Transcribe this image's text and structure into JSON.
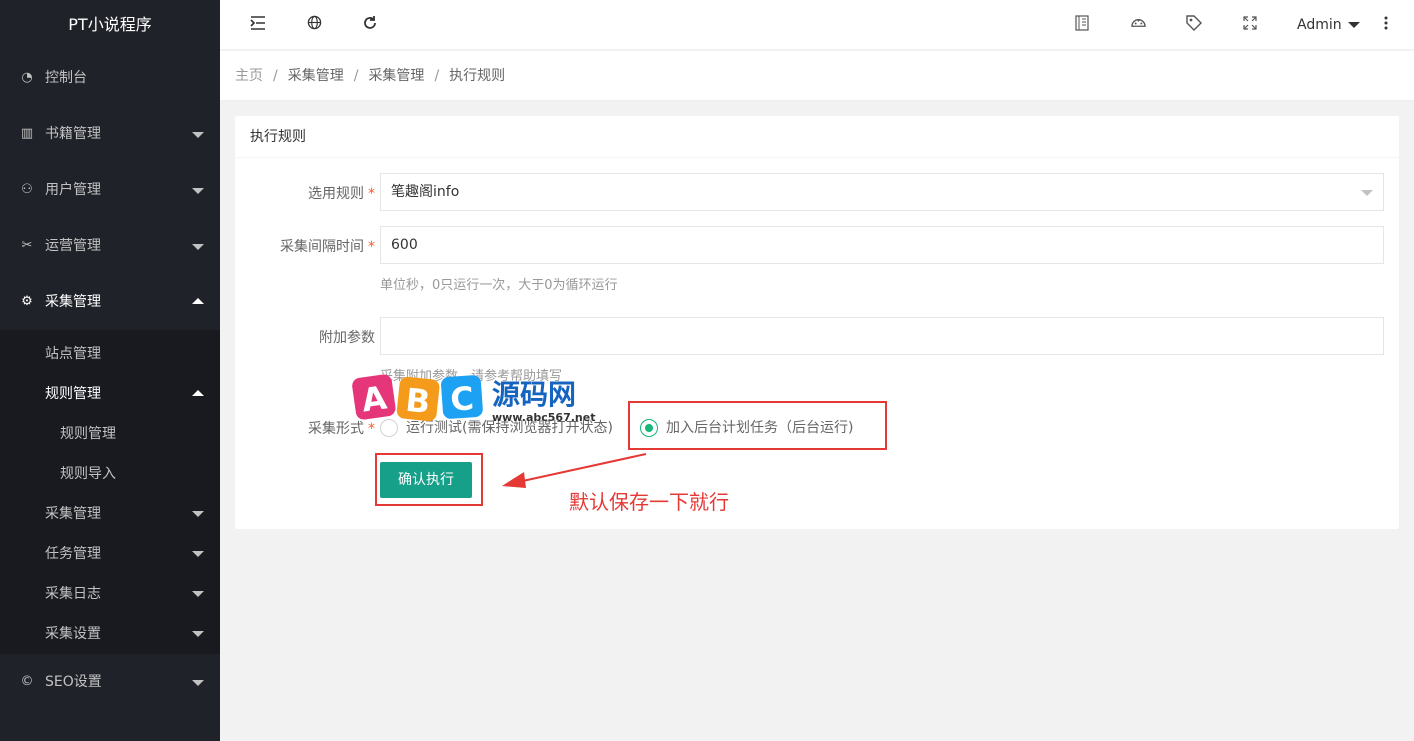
{
  "app": {
    "title": "PT小说程序"
  },
  "sidebar": {
    "items": [
      {
        "label": "控制台",
        "icon": "dashboard-icon"
      },
      {
        "label": "书籍管理",
        "icon": "book-icon"
      },
      {
        "label": "用户管理",
        "icon": "user-icon"
      },
      {
        "label": "运营管理",
        "icon": "operations-icon"
      },
      {
        "label": "采集管理",
        "icon": "gear-icon"
      }
    ],
    "collect_sub": {
      "station": "站点管理",
      "rules": "规则管理",
      "rules_children": [
        "规则管理",
        "规则导入"
      ],
      "collect": "采集管理",
      "tasks": "任务管理",
      "logs": "采集日志",
      "settings": "采集设置"
    },
    "seo": {
      "label": "SEO设置",
      "icon": "seo-icon"
    }
  },
  "header": {
    "icons": [
      "menu-fold-icon",
      "globe-icon",
      "refresh-icon",
      "note-icon",
      "theme-icon",
      "tag-icon",
      "fullscreen-icon",
      "more-icon"
    ],
    "user": "Admin"
  },
  "breadcrumb": [
    "主页",
    "采集管理",
    "采集管理",
    "执行规则"
  ],
  "form": {
    "card_title": "执行规则",
    "rule_label": "选用规则",
    "rule_value": "笔趣阁info",
    "interval_label": "采集间隔时间",
    "interval_value": "600",
    "interval_hint": "单位秒，0只运行一次，大于0为循环运行",
    "param_label": "附加参数",
    "param_value": "",
    "param_hint": "采集附加参数，请参考帮助填写",
    "mode_label": "采集形式",
    "mode_options": [
      "运行测试(需保持浏览器打开状态)",
      "加入后台计划任务（后台运行)"
    ],
    "mode_selected": 1,
    "submit": "确认执行",
    "required_mark": "*"
  },
  "annotation": {
    "note": "默认保存一下就行",
    "color": "#e53935",
    "watermark_letters": [
      "A",
      "B",
      "C"
    ],
    "watermark_text": "源码网",
    "watermark_url": "www.abc567.net"
  },
  "colors": {
    "sidebar": "#20222a",
    "accent": "#16a089",
    "radio": "#16b777"
  }
}
